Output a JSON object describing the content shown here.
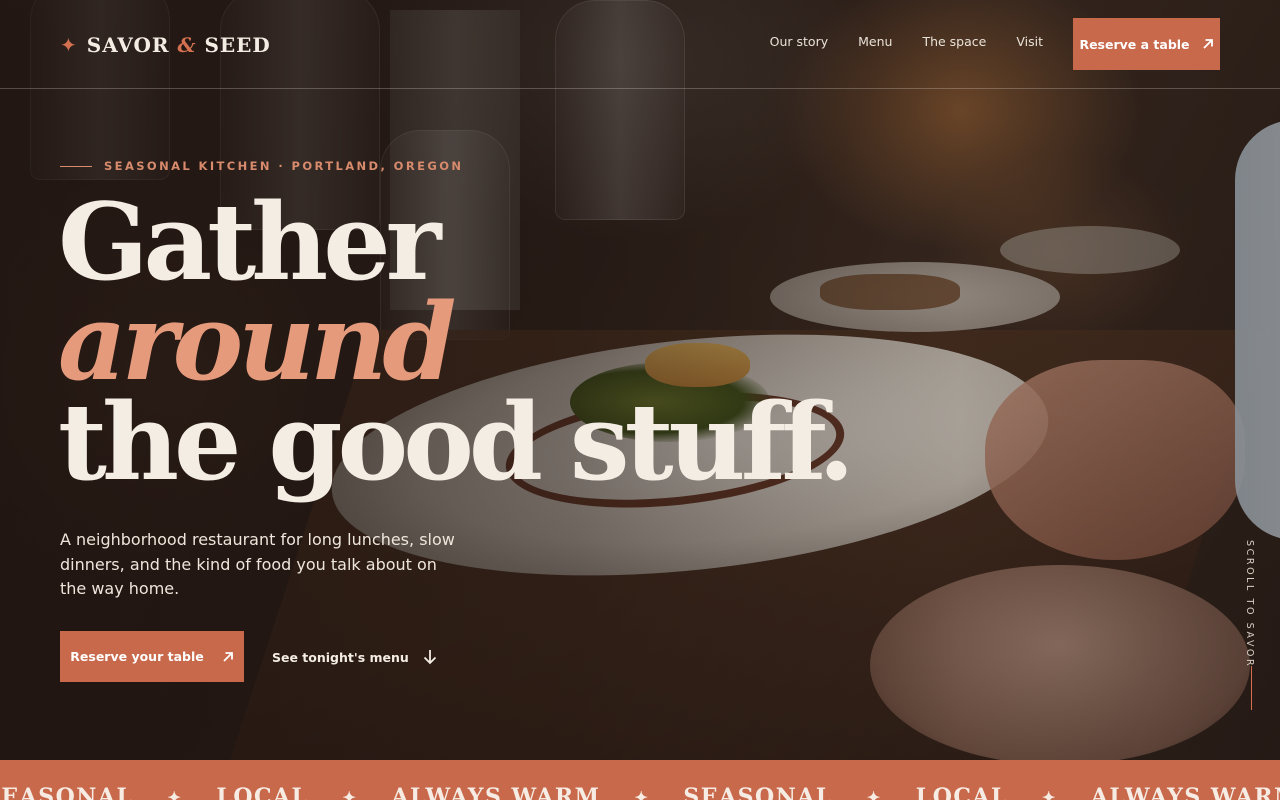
{
  "brand": {
    "name_part1": "SAVOR",
    "ampersand": "&",
    "name_part2": "SEED",
    "accent_color": "#c8694c",
    "highlight_color": "#e59a7c"
  },
  "nav": {
    "items": [
      "Our story",
      "Menu",
      "The space",
      "Visit"
    ],
    "reserve_label": "Reserve a table"
  },
  "hero": {
    "eyebrow": "SEASONAL KITCHEN · PORTLAND, OREGON",
    "headline_line1": "Gather",
    "headline_line2": "around",
    "headline_line3": "the good stuff.",
    "lede": "A neighborhood restaurant for long lunches, slow dinners, and the kind of food you talk about on the way home.",
    "primary_cta": "Reserve your table",
    "secondary_cta": "See tonight's menu",
    "scroll_cue": "SCROLL TO SAVOR"
  },
  "marquee": {
    "items": [
      "SEASONAL",
      "LOCAL",
      "ALWAYS WARM",
      "SEASONAL",
      "LOCAL",
      "ALWAYS WARM"
    ],
    "separator": "✦"
  },
  "icons": {
    "logo": "sparkle-icon",
    "reserve": "arrow-up-right-icon",
    "menu_link": "arrow-down-icon"
  }
}
